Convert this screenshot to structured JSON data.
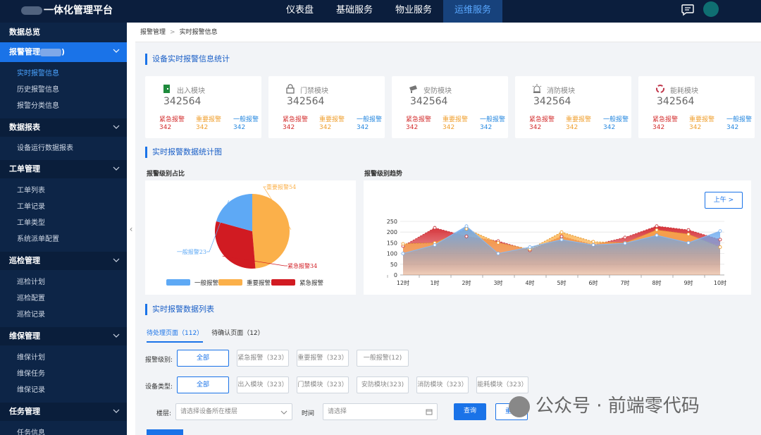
{
  "app": {
    "title": "一体化管理平台"
  },
  "topnav": {
    "items": [
      "仪表盘",
      "基础服务",
      "物业服务",
      "运维服务"
    ],
    "active": 3
  },
  "sidebar": {
    "s_overview": "数据总览",
    "s_alarm": "报警管理",
    "s_alarm_suffix": ")",
    "alarm_items": [
      "实时报警信息",
      "历史报警信息",
      "报警分类信息"
    ],
    "s_report": "数据报表",
    "report_items": [
      "设备运行数据报表"
    ],
    "s_work": "工单管理",
    "work_items": [
      "工单列表",
      "工单记录",
      "工单类型",
      "系统派单配置"
    ],
    "s_patrol": "巡检管理",
    "patrol_items": [
      "巡检计划",
      "巡检配置",
      "巡检记录"
    ],
    "s_maint": "维保管理",
    "maint_items": [
      "维保计划",
      "维保任务",
      "维保记录"
    ],
    "s_task": "任务管理",
    "task_items": [
      "任务信息"
    ]
  },
  "breadcrumb": {
    "parent": "报警管理",
    "current": "实时报警信息"
  },
  "stats": {
    "title": "设备实时报警信息统计",
    "cards": [
      {
        "name": "出入模块",
        "value": "342564",
        "icon": "door-exit-icon"
      },
      {
        "name": "门禁模块",
        "value": "342564",
        "icon": "lock-icon"
      },
      {
        "name": "安防模块",
        "value": "342564",
        "icon": "camera-icon"
      },
      {
        "name": "消防模块",
        "value": "342564",
        "icon": "alarm-light-icon"
      },
      {
        "name": "能耗模块",
        "value": "342564",
        "icon": "recycle-icon"
      }
    ],
    "levels": [
      {
        "label": "紧急报警",
        "value": "342"
      },
      {
        "label": "重要报警",
        "value": "342"
      },
      {
        "label": "一般报警",
        "value": "342"
      }
    ]
  },
  "charts_section": {
    "title": "实时报警数据统计图",
    "pie_title": "报警级别占比",
    "line_title": "报警级别趋势"
  },
  "colors": {
    "normal": "#5ea9f5",
    "important": "#fbb04a",
    "urgent": "#d11b22",
    "accent": "#1a73e8",
    "nav_bg": "#0b1e3d"
  },
  "chart_data": [
    {
      "type": "pie",
      "title": "",
      "slices": [
        {
          "name": "一般报警",
          "value": 23,
          "label": "一般报警23"
        },
        {
          "name": "重要报警",
          "value": 54,
          "label": "重要报警54"
        },
        {
          "name": "紧急报警",
          "value": 34,
          "label": "紧急报警34"
        }
      ],
      "legend": [
        "一般报警",
        "重要报警",
        "紧急报警"
      ],
      "legend_position": "bottom"
    },
    {
      "type": "area",
      "title": "",
      "period_button": "上午 >",
      "categories": [
        "12时",
        "1时",
        "2时",
        "3时",
        "4时",
        "5时",
        "6时",
        "7时",
        "8时",
        "9时",
        "10时"
      ],
      "ylim": [
        0,
        250
      ],
      "yticks": [
        0,
        50,
        100,
        150,
        200,
        250
      ],
      "grid": true,
      "series": [
        {
          "values": [
            135,
            220,
            180,
            158,
            115,
            180,
            140,
            175,
            228,
            210,
            165
          ]
        },
        {
          "values": [
            145,
            150,
            215,
            150,
            120,
            200,
            155,
            150,
            210,
            190,
            130
          ]
        },
        {
          "values": [
            100,
            140,
            228,
            100,
            130,
            165,
            140,
            148,
            185,
            150,
            205
          ]
        }
      ]
    }
  ],
  "list": {
    "title": "实时报警数据列表",
    "tabs": [
      "待处理页面（112）",
      "待确认页面（12）"
    ],
    "level_label": "报警级别:",
    "level_options": [
      "全部",
      "紧急报警（323）",
      "重要报警（323）",
      "一般报警(12)"
    ],
    "type_label": "设备类型:",
    "type_options": [
      "全部",
      "出入模块（323）",
      "门禁模块（323）",
      "安防模块(323)",
      "消防模块（323）",
      "能耗模块（323）"
    ],
    "floor_label": "楼层:",
    "floor_placeholder": "请选择设备所在楼层",
    "time_label": "时间",
    "time_placeholder": "请选择",
    "query": "查询",
    "reset": "重置"
  },
  "watermark": "公众号 · 前端零代码"
}
